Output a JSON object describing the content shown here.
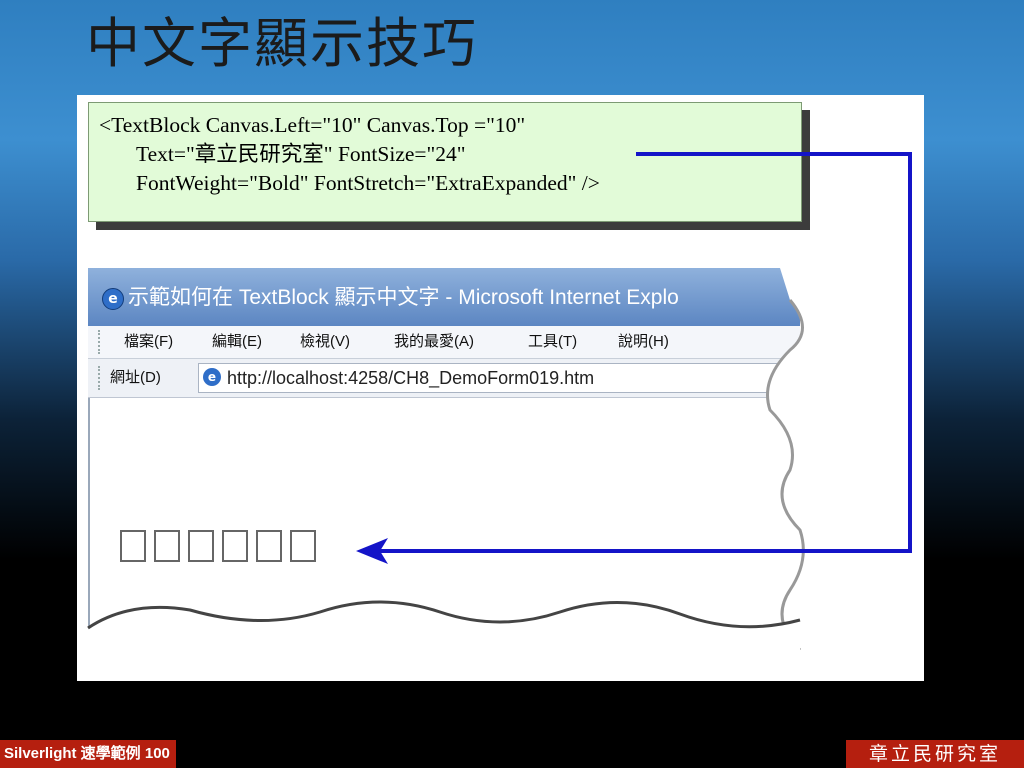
{
  "slide": {
    "title": "中文字顯示技巧"
  },
  "code_box": {
    "line1": "<TextBlock Canvas.Left=\"10\" Canvas.Top =\"10\"",
    "line2": "Text=\"章立民研究室\" FontSize=\"24\"",
    "line3": "FontWeight=\"Bold\" FontStretch=\"ExtraExpanded\" />"
  },
  "browser": {
    "title": "示範如何在 TextBlock 顯示中文字 - Microsoft Internet Explo",
    "menu": [
      {
        "label": "檔案(F)"
      },
      {
        "label": "編輯(E)"
      },
      {
        "label": "檢視(V)"
      },
      {
        "label": "我的最愛(A)"
      },
      {
        "label": "工具(T)"
      },
      {
        "label": "說明(H)"
      }
    ],
    "address_label": "網址(D)",
    "address_url": "http://localhost:4258/CH8_DemoForm019.htm",
    "rendered_glyph_count": 6
  },
  "footer": {
    "left_label": "Silverlight 速學範例 100",
    "right_label": "章立民研究室"
  },
  "colors": {
    "arrow": "#1414c8",
    "code_background": "#e2fbd8",
    "stamp": "#b51f0f"
  },
  "icons": [
    "ie-icon",
    "arrow-icon"
  ]
}
